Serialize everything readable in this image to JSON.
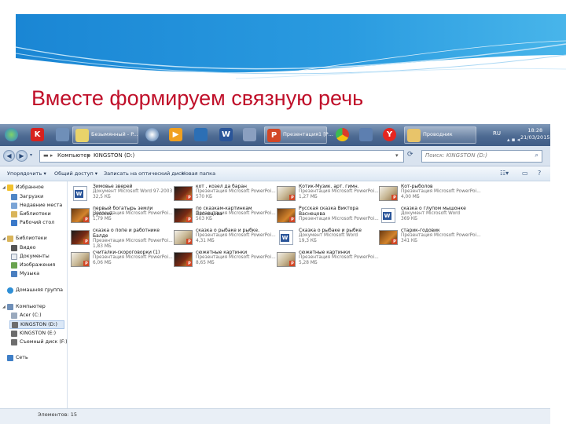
{
  "slide": {
    "title": "Вместе формируем связную речь",
    "accent": "#c0102a",
    "band": "#1e8ed9"
  },
  "taskbar": {
    "apps": [
      {
        "label": "Безымянный - P...",
        "icon": "paint-icon"
      },
      {
        "label": "Презентация1 [Р...",
        "icon": "powerpoint-icon"
      },
      {
        "label": "Проводник",
        "icon": "explorer-folder-icon"
      }
    ],
    "lang": "RU",
    "clock_time": "18:28",
    "clock_date": "21/03/2015"
  },
  "address": {
    "crumbs": [
      "Компьютер",
      "KINGSTON (D:)"
    ],
    "search_placeholder": "Поиск: KINGSTON (D:)"
  },
  "commands": [
    "Упорядочить ▾",
    "Общий доступ ▾",
    "Записать на оптический диск",
    "Новая папка"
  ],
  "nav": {
    "favorites": "Избранное",
    "favorites_items": [
      "Загрузки",
      "Недавние места",
      "Библиотеки",
      "Рабочий стол"
    ],
    "libraries": "Библиотеки",
    "libraries_items": [
      "Видео",
      "Документы",
      "Изображения",
      "Музыка"
    ],
    "homegroup": "Домашняя группа",
    "computer": "Компьютер",
    "computer_items": [
      "Acer (C:)",
      "KINGSTON (D:)",
      "KINGSTON (E:)",
      "Съемный диск (F:)"
    ],
    "network": "Сеть"
  },
  "files": [
    {
      "name": "Зимовье зверей",
      "type": "Документ Microsoft Word 97-2003",
      "size": "32,5 КБ",
      "kind": "word"
    },
    {
      "name": "кот , козел да баран",
      "type": "Презентация Microsoft PowerPoi...",
      "size": "570 КБ",
      "kind": "ppd"
    },
    {
      "name": "Котик-Музик. арт. гимн.",
      "type": "Презентация Microsoft PowerPoi...",
      "size": "1,27 МБ",
      "kind": "ppl"
    },
    {
      "name": "Кот-рыболов",
      "type": "Презентация Microsoft PowerPoi...",
      "size": "4,00 МБ",
      "kind": "ppl"
    },
    {
      "name": "первый богатырь земли русской",
      "type": "Презентация Microsoft PowerPoi...",
      "size": "1,79 МБ",
      "kind": "pp"
    },
    {
      "name": "по сказкам-картинкам Васнецова",
      "type": "Презентация Microsoft PowerPoi...",
      "size": "503 КБ",
      "kind": "ppd"
    },
    {
      "name": "Русская сказка Виктора Васнецова",
      "type": "Презентация Microsoft PowerPoi...",
      "size": "",
      "kind": "pp"
    },
    {
      "name": "сказка о глупом мышонке",
      "type": "Документ Microsoft Word",
      "size": "369 КБ",
      "kind": "word"
    },
    {
      "name": "сказка о попе и работнике Балде",
      "type": "Презентация Microsoft PowerPoi...",
      "size": "1,83 МБ",
      "kind": "ppd"
    },
    {
      "name": "сказка о рыбаке и рыбке.",
      "type": "Презентация Microsoft PowerPoi...",
      "size": "4,31 МБ",
      "kind": "ppl"
    },
    {
      "name": "Сказка о рыбаке и рыбке",
      "type": "Документ Microsoft Word",
      "size": "19,3 КБ",
      "kind": "word"
    },
    {
      "name": "старик-годовик",
      "type": "Презентация Microsoft PowerPoi...",
      "size": "341 КБ",
      "kind": "pp"
    },
    {
      "name": "считалки-скороговорки (1)",
      "type": "Презентация Microsoft PowerPoi...",
      "size": "6,06 МБ",
      "kind": "ppl"
    },
    {
      "name": "сюжетные картинки",
      "type": "Презентация Microsoft PowerPoi...",
      "size": "8,65 МБ",
      "kind": "ppd"
    },
    {
      "name": "сюжетные картинки",
      "type": "Презентация Microsoft PowerPoi...",
      "size": "5,28 МБ",
      "kind": "ppl"
    }
  ],
  "status": {
    "items": "Элементов: 15"
  }
}
